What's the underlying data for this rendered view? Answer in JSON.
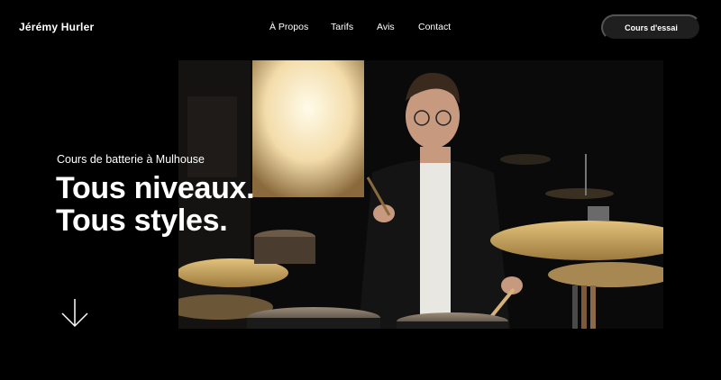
{
  "header": {
    "brand": "Jérémy Hurler",
    "nav": [
      "À Propos",
      "Tarifs",
      "Avis",
      "Contact"
    ],
    "cta_label": "Cours d'essai"
  },
  "hero": {
    "subtitle": "Cours de batterie à Mulhouse",
    "headline_line1": "Tous niveaux.",
    "headline_line2": "Tous styles.",
    "scroll_icon": "arrow-down-icon",
    "photo_subject": "drummer-photo"
  },
  "colors": {
    "background": "#000000",
    "text": "#ffffff",
    "button_bg": "#1f1f1f",
    "cymbal": "#c9a45c"
  }
}
